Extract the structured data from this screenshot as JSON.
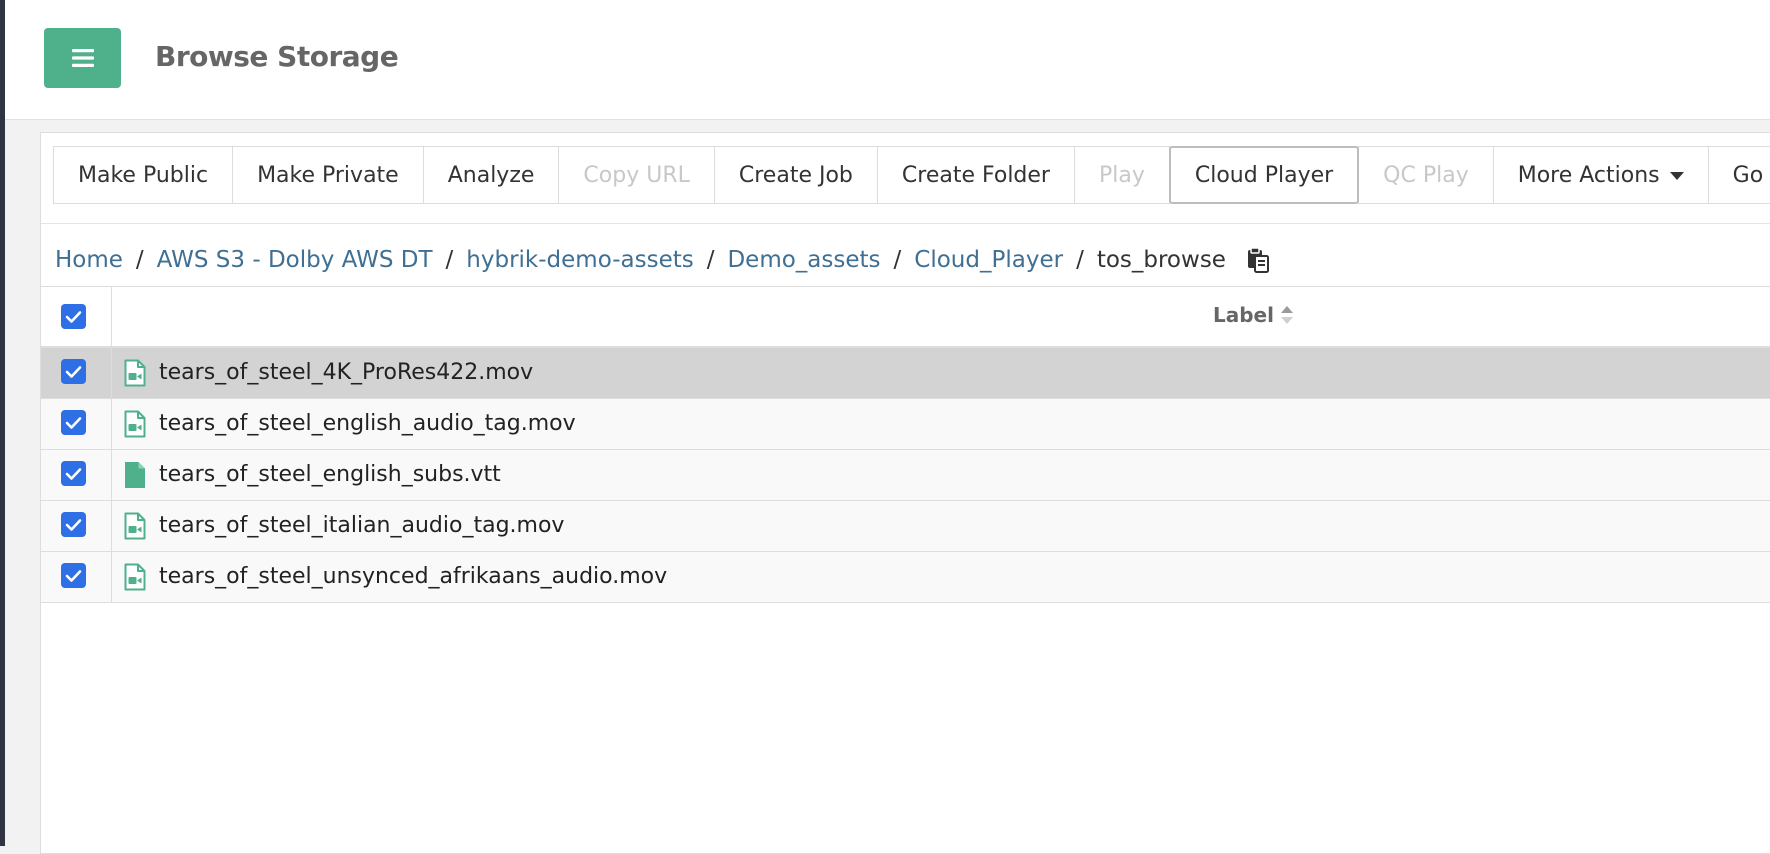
{
  "header": {
    "menu_icon": "hamburger-icon",
    "title": "Browse Storage"
  },
  "toolbar": {
    "buttons": [
      {
        "label": "Make Public",
        "state": "enabled"
      },
      {
        "label": "Make Private",
        "state": "enabled"
      },
      {
        "label": "Analyze",
        "state": "enabled"
      },
      {
        "label": "Copy URL",
        "state": "disabled"
      },
      {
        "label": "Create Job",
        "state": "enabled"
      },
      {
        "label": "Create Folder",
        "state": "enabled"
      },
      {
        "label": "Play",
        "state": "disabled"
      },
      {
        "label": "Cloud Player",
        "state": "active"
      },
      {
        "label": "QC Play",
        "state": "disabled"
      },
      {
        "label": "More Actions",
        "state": "enabled"
      },
      {
        "label": "Go",
        "state": "enabled"
      }
    ]
  },
  "breadcrumb": {
    "links": [
      "Home",
      "AWS S3 - Dolby AWS DT",
      "hybrik-demo-assets",
      "Demo_assets",
      "Cloud_Player"
    ],
    "separator": "/",
    "current": "tos_browse",
    "copy_icon": "copy-clipboard-icon"
  },
  "table": {
    "header_label": "Label",
    "sort_icon": "sort-icon",
    "select_all_checked": true,
    "rows": [
      {
        "name": "tears_of_steel_4K_ProRes422.mov",
        "icon": "video-file-icon",
        "checked": true,
        "selected": true
      },
      {
        "name": "tears_of_steel_english_audio_tag.mov",
        "icon": "video-file-icon",
        "checked": true,
        "selected": false
      },
      {
        "name": "tears_of_steel_english_subs.vtt",
        "icon": "document-file-icon",
        "checked": true,
        "selected": false
      },
      {
        "name": "tears_of_steel_italian_audio_tag.mov",
        "icon": "video-file-icon",
        "checked": true,
        "selected": false
      },
      {
        "name": "tears_of_steel_unsynced_afrikaans_audio.mov",
        "icon": "video-file-icon",
        "checked": true,
        "selected": false
      }
    ]
  },
  "colors": {
    "accent": "#4fb08c",
    "link": "#3f6f92",
    "checkbox": "#2f6fe6",
    "selected_row": "#d3d3d3",
    "sidebar_strip": "#2f3542"
  }
}
